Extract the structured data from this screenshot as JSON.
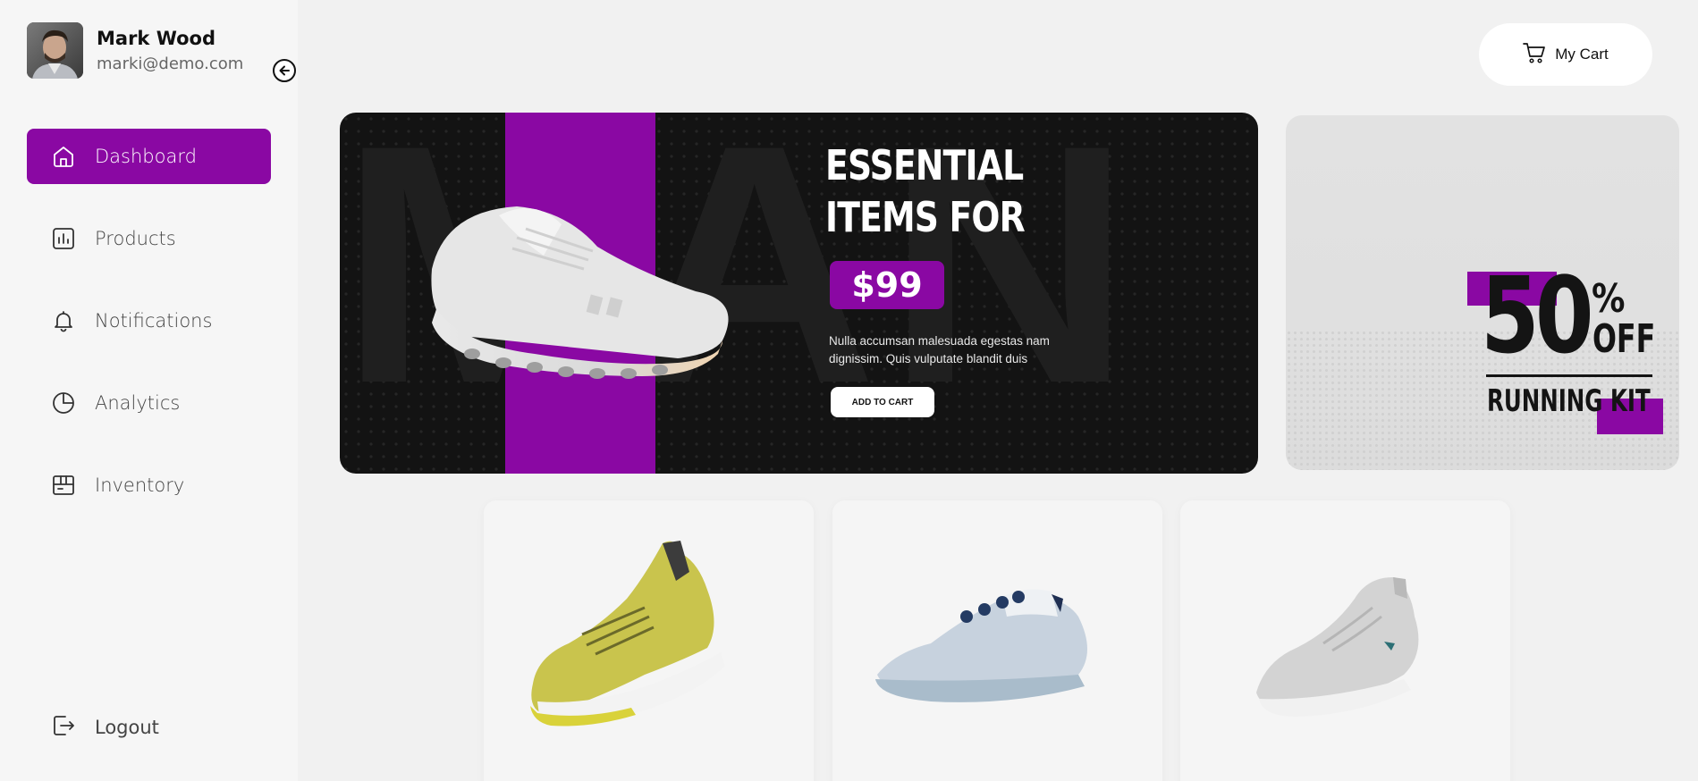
{
  "user": {
    "name": "Mark Wood",
    "email": "marki@demo.com"
  },
  "nav": {
    "items": [
      {
        "label": "Dashboard",
        "icon": "home-icon",
        "active": true
      },
      {
        "label": "Products",
        "icon": "bar-chart-icon",
        "active": false
      },
      {
        "label": "Notifications",
        "icon": "bell-icon",
        "active": false
      },
      {
        "label": "Analytics",
        "icon": "pie-chart-icon",
        "active": false
      },
      {
        "label": "Inventory",
        "icon": "box-icon",
        "active": false
      }
    ],
    "logout_label": "Logout"
  },
  "header": {
    "cart_label": "My Cart"
  },
  "hero": {
    "title_line1": "ESSENTIAL",
    "title_line2": "ITEMS FOR",
    "price": "$99",
    "description": "Nulla accumsan malesuada egestas nam dignissim. Quis vulputate blandit duis",
    "button_label": "ADD TO CART"
  },
  "promo": {
    "number": "50",
    "percent": "%",
    "off": "OFF",
    "tagline": "RUNNING KIT"
  },
  "colors": {
    "accent": "#8a08a3",
    "hero_bg": "#131313",
    "page_bg": "#f1f1f1"
  }
}
